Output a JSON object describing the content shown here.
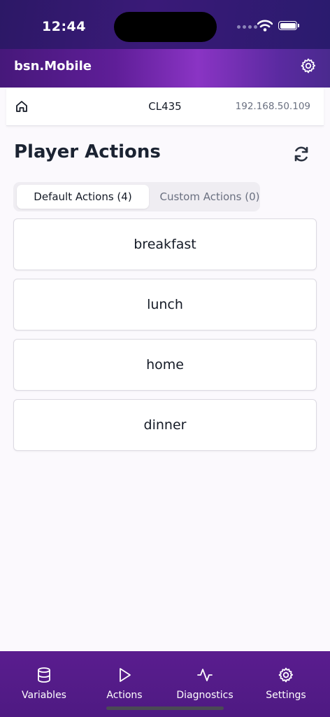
{
  "status_bar": {
    "time": "12:44"
  },
  "app_bar": {
    "title": "bsn.Mobile"
  },
  "device_bar": {
    "name": "CL435",
    "ip": "192.168.50.109"
  },
  "page": {
    "title": "Player Actions"
  },
  "tabs": [
    {
      "label": "Default Actions (4)",
      "active": true
    },
    {
      "label": "Custom Actions (0)",
      "active": false
    }
  ],
  "actions": [
    "breakfast",
    "lunch",
    "home",
    "dinner"
  ],
  "bottom_nav": [
    {
      "label": "Variables",
      "icon": "database-icon"
    },
    {
      "label": "Actions",
      "icon": "play-icon",
      "active": true
    },
    {
      "label": "Diagnostics",
      "icon": "activity-icon"
    },
    {
      "label": "Settings",
      "icon": "gear-icon"
    }
  ],
  "colors": {
    "brand": "#5a1d8f",
    "accent": "#8a34c4",
    "text": "#141a26",
    "muted": "#6a7080"
  }
}
